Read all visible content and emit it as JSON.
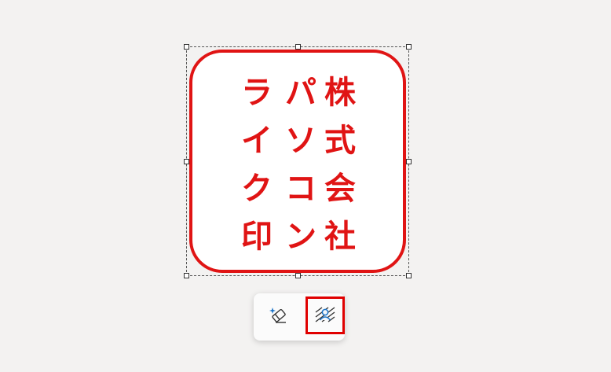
{
  "stamp": {
    "columns": [
      [
        "株",
        "式",
        "会",
        "社"
      ],
      [
        "パ",
        "ソ",
        "コ",
        "ン"
      ],
      [
        "ラ",
        "イ",
        "ク",
        "印"
      ]
    ],
    "color": "#e01414"
  },
  "toolbar": {
    "buttons": [
      {
        "icon": "magic-eraser-icon"
      },
      {
        "icon": "remove-background-icon",
        "highlight": "#e00000"
      }
    ]
  }
}
